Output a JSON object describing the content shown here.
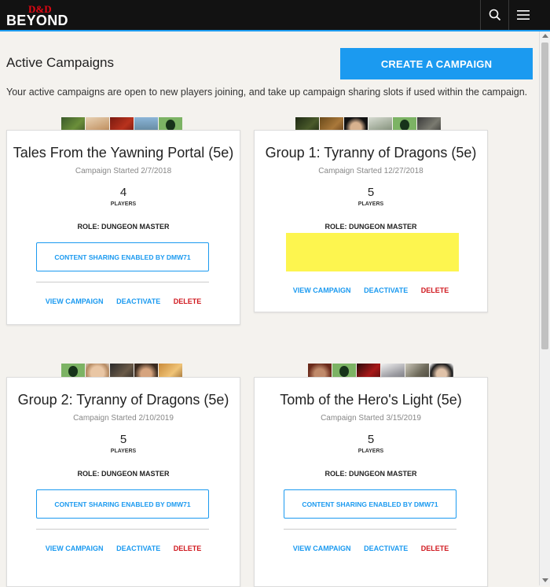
{
  "brand": {
    "logo_top": "D&D",
    "logo_bottom": "BEYOND"
  },
  "header": {
    "search_icon": "search-icon",
    "menu_icon": "hamburger-menu-icon"
  },
  "page": {
    "title": "Active Campaigns",
    "create_button": "CREATE A CAMPAIGN",
    "intro": "Your active campaigns are open to new players joining, and take up campaign sharing slots if used within the campaign."
  },
  "colors": {
    "accent": "#1b9af0",
    "danger": "#d0181f",
    "highlight": "#fdf54f",
    "topbar": "#121212"
  },
  "campaigns": [
    {
      "name": "Tales From the Yawning Portal (5e)",
      "started": "Campaign Started 2/7/2018",
      "player_count": "4",
      "players_label": "PLAYERS",
      "role": "ROLE: DUNGEON MASTER",
      "sharing": "CONTENT SHARING ENABLED BY DMW71",
      "view": "VIEW CAMPAIGN",
      "deactivate": "DEACTIVATE",
      "delete": "DELETE"
    },
    {
      "name": "Group 1: Tyranny of Dragons (5e)",
      "started": "Campaign Started 12/27/2018",
      "player_count": "5",
      "players_label": "PLAYERS",
      "role": "ROLE: DUNGEON MASTER",
      "view": "VIEW CAMPAIGN",
      "deactivate": "DEACTIVATE",
      "delete": "DELETE"
    },
    {
      "name": "Group 2: Tyranny of Dragons (5e)",
      "started": "Campaign Started 2/10/2019",
      "player_count": "5",
      "players_label": "PLAYERS",
      "role": "ROLE: DUNGEON MASTER",
      "sharing": "CONTENT SHARING ENABLED BY DMW71",
      "view": "VIEW CAMPAIGN",
      "deactivate": "DEACTIVATE",
      "delete": "DELETE"
    },
    {
      "name": "Tomb of the Hero's Light (5e)",
      "started": "Campaign Started 3/15/2019",
      "player_count": "5",
      "players_label": "PLAYERS",
      "role": "ROLE: DUNGEON MASTER",
      "sharing": "CONTENT SHARING ENABLED BY DMW71",
      "view": "VIEW CAMPAIGN",
      "deactivate": "DEACTIVATE",
      "delete": "DELETE"
    }
  ]
}
